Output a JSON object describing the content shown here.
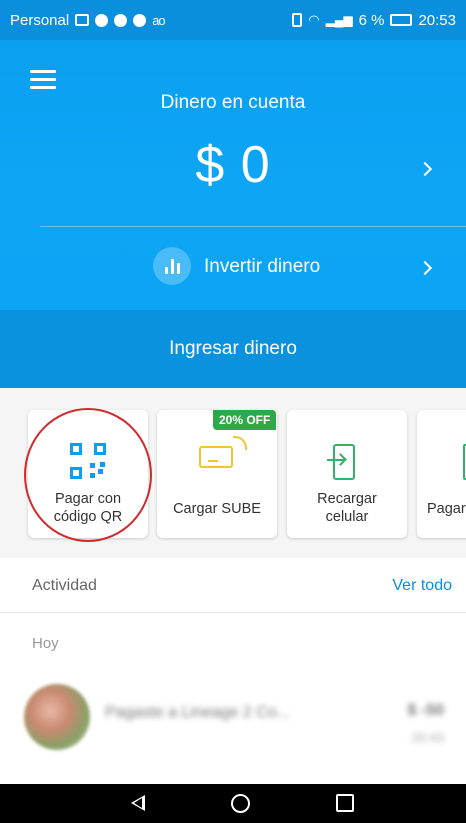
{
  "status_bar": {
    "carrier": "Personal",
    "voicemail": "ao",
    "battery": "6 %",
    "time": "20:53",
    "icons": [
      "mail-icon",
      "whatsapp-icon",
      "chat-icon",
      "messenger-icon",
      "voicemail-icon",
      "vibrate-icon",
      "wifi-icon",
      "signal-icon",
      "battery-icon"
    ]
  },
  "header": {
    "balance_title": "Dinero en cuenta",
    "balance_value": "$ 0",
    "invest_label": "Invertir dinero",
    "deposit_label": "Ingresar dinero"
  },
  "shortcuts": [
    {
      "label": "Pagar con\ncódigo QR",
      "icon": "qr-code-icon"
    },
    {
      "label": "Cargar SUBE",
      "icon": "sube-card-icon",
      "badge": "20% OFF"
    },
    {
      "label": "Recargar\ncelular",
      "icon": "phone-recharge-icon"
    },
    {
      "label": "Pagar",
      "icon": "pay-icon"
    }
  ],
  "activity": {
    "title": "Actividad",
    "see_all": "Ver todo",
    "day": "Hoy",
    "transactions": [
      {
        "description": "Pagaste a Lineage 2 Co...",
        "amount": "$ -50",
        "time": "20:43"
      }
    ]
  },
  "colors": {
    "brand_blue": "#0a9ff0",
    "deposit_band": "#0a92df",
    "badge_green": "#2ea84a",
    "highlight_red": "#d12a2a",
    "link_blue": "#0a8fdc"
  }
}
